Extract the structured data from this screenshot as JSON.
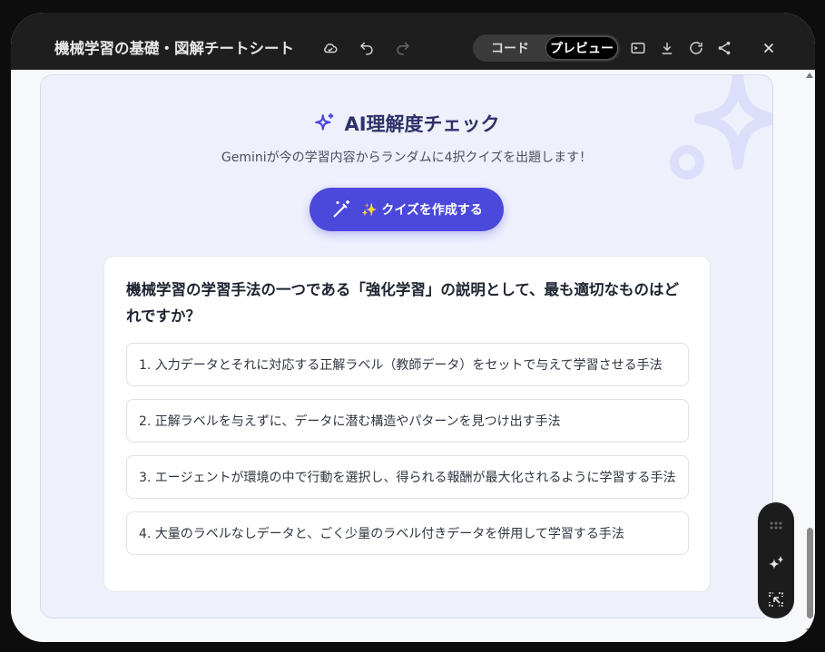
{
  "window": {
    "title": "機械学習の基礎・図解チートシート",
    "toggle": {
      "code_label": "コード",
      "preview_label": "プレビュー",
      "active": "preview"
    }
  },
  "card": {
    "title": "AI理解度チェック",
    "subtitle": "Geminiが今の学習内容からランダムに4択クイズを出題します！",
    "button_label": "✨ クイズを作成する"
  },
  "quiz": {
    "question": "機械学習の学習手法の一つである「強化学習」の説明として、最も適切なものはどれですか？",
    "options": [
      "1. 入力データとそれに対応する正解ラベル（教師データ）をセットで与えて学習させる手法",
      "2. 正解ラベルを与えずに、データに潜む構造やパターンを見つけ出す手法",
      "3. エージェントが環境の中で行動を選択し、得られる報酬が最大化されるように学習する手法",
      "4. 大量のラベルなしデータと、ごく少量のラベル付きデータを併用して学習する手法"
    ]
  },
  "colors": {
    "accent": "#4b48dc",
    "title_color": "#2e3069",
    "card_bg": "#eef0fc"
  },
  "icons": [
    "cloud-icon",
    "undo-icon",
    "redo-icon",
    "terminal-icon",
    "download-icon",
    "refresh-icon",
    "share-icon",
    "close-icon",
    "sparkle-icon",
    "magic-wand-icon",
    "drag-handle-icon",
    "sparkle-edit-icon",
    "select-icon"
  ]
}
